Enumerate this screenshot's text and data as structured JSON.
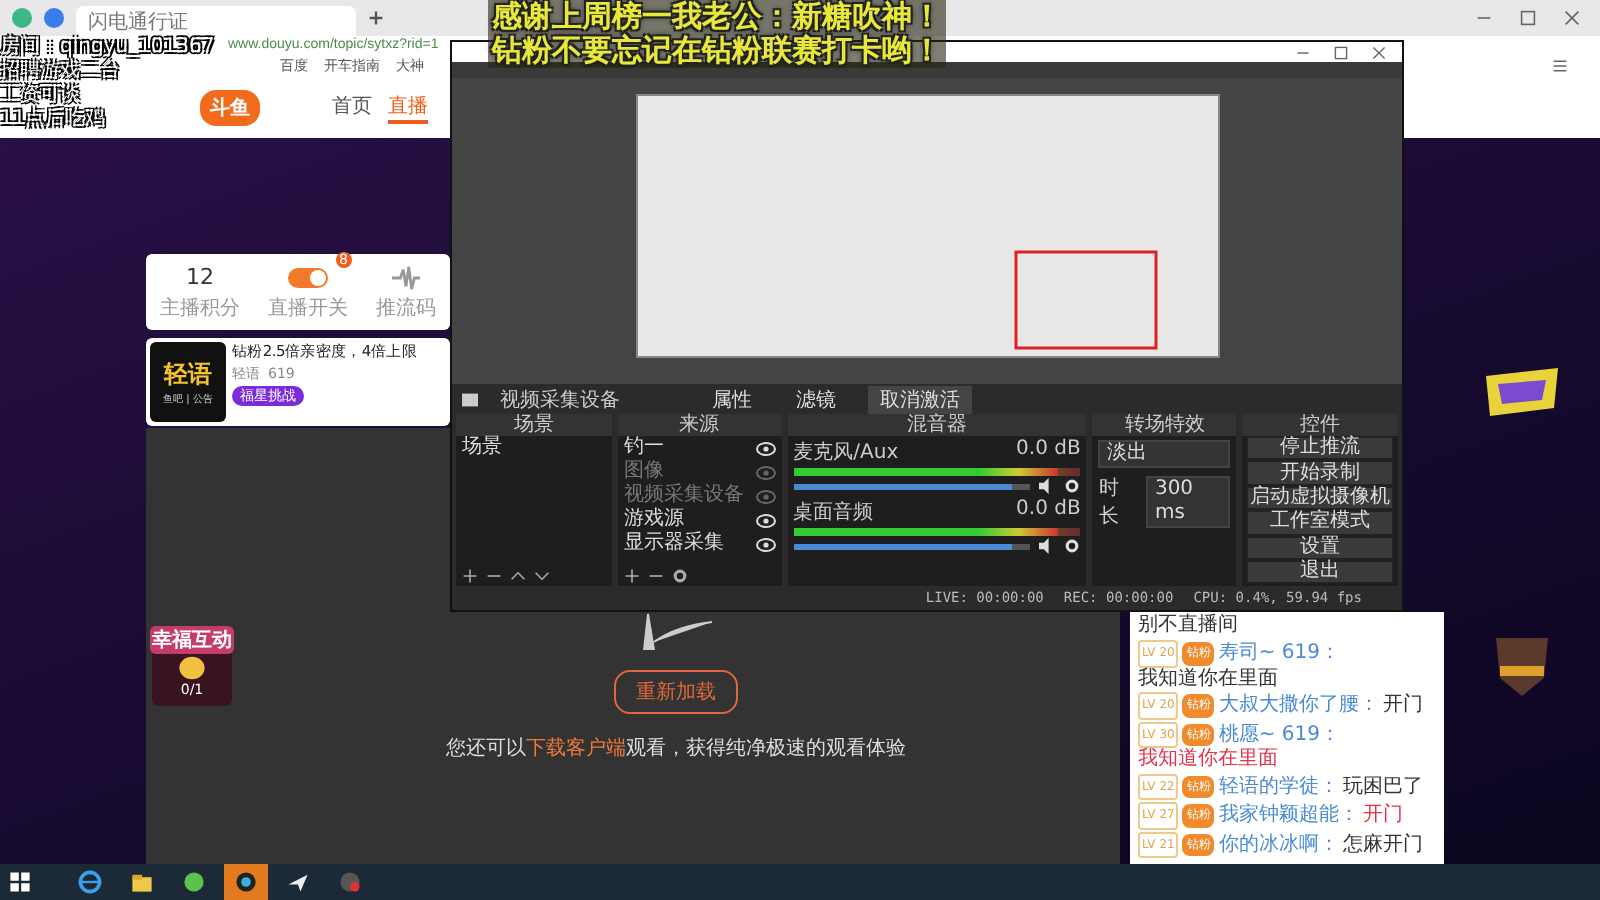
{
  "browser": {
    "tab_title": "闪电通行证",
    "url": "www.douyu.com/topic/sytxz?rid=1",
    "bookmarks": [
      "百度",
      "开车指南",
      "大神"
    ]
  },
  "overlay_lines": [
    "房间：qingyu_101367",
    "招聘游戏二台",
    "工资可谈",
    "11点后吃鸡"
  ],
  "caption_lines": [
    "感谢上周榜一我老公：新糖吹神！",
    "钻粉不要忘记在钻粉联赛打卡哟！"
  ],
  "site": {
    "logo": "斗鱼",
    "nav": [
      {
        "label": "首页",
        "selected": false
      },
      {
        "label": "直播",
        "selected": true
      }
    ]
  },
  "stats": [
    {
      "kind": "number",
      "value": "12",
      "label": "主播积分"
    },
    {
      "kind": "toggle",
      "on": true,
      "badge": "8",
      "label": "直播开关"
    },
    {
      "kind": "wave",
      "label": "推流码"
    }
  ],
  "anchor": {
    "logo": "轻语",
    "logo_sub": "鱼吧 | 公告",
    "headline": "钻粉2.5倍亲密度，4倍上限",
    "name": "轻语",
    "fans": "619",
    "tag": "福星挑战"
  },
  "obs": {
    "source_label": "视频采集设备",
    "source_buttons": [
      "属性",
      "滤镜",
      "取消激活"
    ],
    "scenes": {
      "title": "场景",
      "items": [
        "场景"
      ]
    },
    "sources": {
      "title": "来源",
      "items": [
        {
          "name": "钓一",
          "visible": true
        },
        {
          "name": "图像",
          "visible": false
        },
        {
          "name": "视频采集设备",
          "visible": false
        },
        {
          "name": "游戏源",
          "visible": true
        },
        {
          "name": "显示器采集",
          "visible": true
        }
      ]
    },
    "mixer": {
      "title": "混音器",
      "channels": [
        {
          "name": "麦克风/Aux",
          "reading": "0.0 dB",
          "level": 0.92
        },
        {
          "name": "桌面音频",
          "reading": "0.0 dB",
          "level": 0.92
        }
      ]
    },
    "transitions": {
      "title": "转场特效",
      "select": "淡出",
      "duration_label": "时长",
      "duration": "300 ms"
    },
    "controls": {
      "title": "控件",
      "buttons": [
        "停止推流",
        "开始录制",
        "启动虚拟摄像机",
        "工作室模式",
        "设置",
        "退出"
      ]
    },
    "status": {
      "live": "LIVE: 00:00:00",
      "rec": "REC: 00:00:00",
      "cpu": "CPU: 0.4%, 59.94 fps"
    }
  },
  "player": {
    "reload": "重新加载",
    "hint_before": "您还可以",
    "hint_link": "下载客户端",
    "hint_after": "观看，获得纯净极速的观看体验"
  },
  "interaction": {
    "title": "幸福互动",
    "count": "0/1"
  },
  "chat": {
    "title": "别不直播间",
    "messages": [
      {
        "level": "LV 20",
        "badge": "钻粉",
        "name": "寿司~ 619：",
        "text": "我知道你在里面",
        "highlight": false
      },
      {
        "level": "LV 20",
        "badge": "钻粉",
        "name": "大叔大撒你了腰：",
        "text": "开门",
        "highlight": false
      },
      {
        "level": "LV 30",
        "badge": "钻粉",
        "name": "桃愿~ 619：",
        "text": "我知道你在里面",
        "highlight": true
      },
      {
        "level": "LV 22",
        "badge": "钻粉",
        "name": "轻语的学徒：",
        "text": "玩困巴了",
        "highlight": false
      },
      {
        "level": "LV 27",
        "badge": "钻粉",
        "name": "我家钟颖超能：",
        "text": "开门",
        "highlight": true
      },
      {
        "level": "LV 21",
        "badge": "钻粉",
        "name": "你的冰冰啊：",
        "text": "怎麻开门",
        "highlight": false
      }
    ]
  },
  "taskbar": [
    {
      "kind": "ie",
      "selected": false
    },
    {
      "kind": "folder",
      "selected": false
    },
    {
      "kind": "green",
      "selected": false
    },
    {
      "kind": "obs",
      "selected": true
    },
    {
      "kind": "plane",
      "selected": false
    },
    {
      "kind": "record",
      "selected": false
    }
  ]
}
